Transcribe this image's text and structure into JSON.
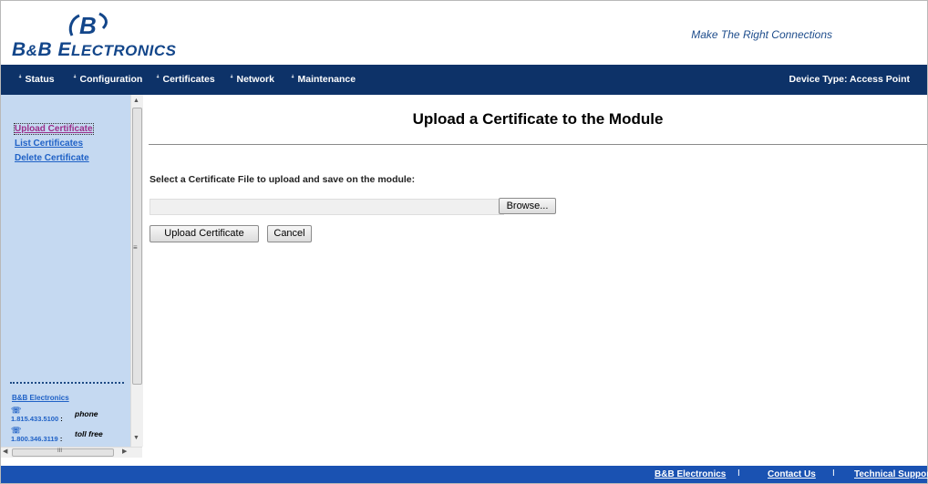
{
  "header": {
    "logo_mark": "B",
    "logo_text_big1": "B",
    "logo_text_amp": "&",
    "logo_text_big2": "B E",
    "logo_text_small": "LECTRONICS",
    "tagline": "Make The Right Connections"
  },
  "nav": {
    "items": [
      {
        "label": "Status",
        "icon": "double-chevron-down-icon"
      },
      {
        "label": "Configuration",
        "icon": "double-chevron-down-icon"
      },
      {
        "label": "Certificates",
        "icon": "double-chevron-down-icon"
      },
      {
        "label": "Network",
        "icon": "double-chevron-down-icon"
      },
      {
        "label": "Maintenance",
        "icon": "double-chevron-down-icon"
      }
    ],
    "arrow": "ꜜ",
    "device_type": "Device Type: Access Point"
  },
  "sidebar": {
    "links": [
      {
        "label": "Upload Certificate"
      },
      {
        "label": "List Certificates"
      },
      {
        "label": "Delete Certificate"
      }
    ],
    "company": "B&B Electronics",
    "contacts": [
      {
        "number": "1.815.433.5100",
        "sep": ":",
        "label": "phone",
        "icon": "phone-icon"
      },
      {
        "number": "1.800.346.3119",
        "sep": ":",
        "label": "toll free",
        "icon": "phone-icon"
      }
    ],
    "hthumb_grip": "III"
  },
  "main": {
    "title": "Upload a Certificate to the Module",
    "prompt": "Select a Certificate File to upload and save on the module:",
    "file_value": "",
    "browse_label": "Browse...",
    "upload_label": "Upload Certificate",
    "cancel_label": "Cancel"
  },
  "footer": {
    "links": [
      {
        "label": "B&B Electronics"
      },
      {
        "label": "Contact Us"
      },
      {
        "label": "Technical Support"
      }
    ],
    "separator": "I"
  },
  "colors": {
    "nav_bg": "#0d3268",
    "sidebar_bg": "#c5d9f1",
    "footer_bg": "#1a52b2",
    "link": "#1f61c6",
    "visited_link": "#9b2e8a"
  }
}
